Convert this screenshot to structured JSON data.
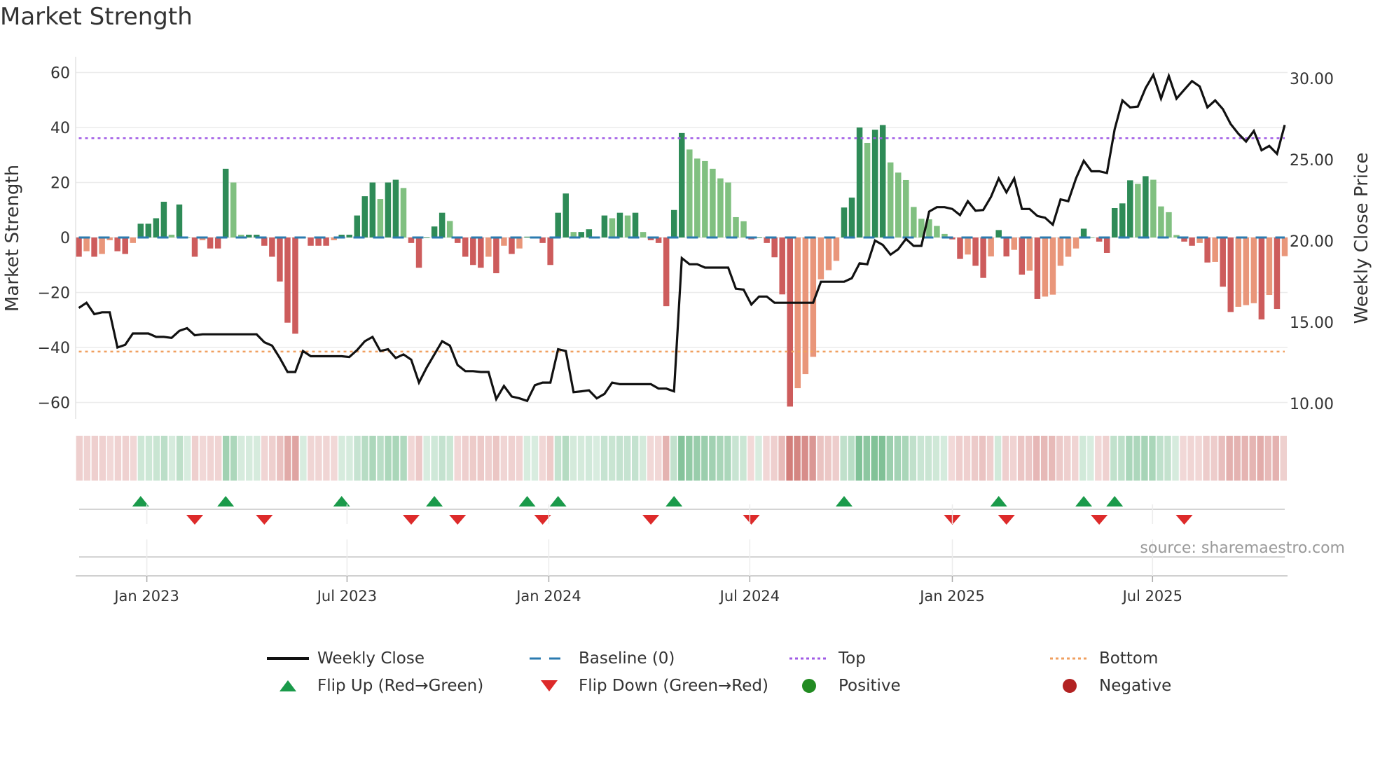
{
  "title": "Market Strength",
  "source": "source: sharemaestro.com",
  "colors": {
    "pos_strong": "#2e8b57",
    "pos_weak": "#80c080",
    "neg_strong": "#cd5c5c",
    "neg_weak": "#e9967a",
    "close": "#111111",
    "baseline": "#2b7bb0",
    "top": "#a05be6",
    "bottom": "#f0a060",
    "flip_up": "#1a9a4a",
    "flip_down": "#dd2a2a",
    "positive": "#228b22",
    "negative": "#b22222"
  },
  "legend": {
    "weekly_close": "Weekly Close",
    "baseline": "Baseline (0)",
    "top": "Top",
    "bottom": "Bottom",
    "flip_up": "Flip Up (Red→Green)",
    "flip_down": "Flip Down (Green→Red)",
    "positive": "Positive",
    "negative": "Negative"
  },
  "chart_data": {
    "type": "bar+line",
    "title": "Market Strength",
    "ylabel": "Market Strength",
    "y2label": "Weekly Close Price",
    "ylim": [
      -66,
      66
    ],
    "y2lim": [
      9.03,
      31.5
    ],
    "x_unit": "week index",
    "y_ticks": [
      {
        "value": 60,
        "label": "60"
      },
      {
        "value": 40,
        "label": "40"
      },
      {
        "value": 20,
        "label": "20"
      },
      {
        "value": 0,
        "label": "0"
      },
      {
        "value": -20,
        "label": "−20"
      },
      {
        "value": -40,
        "label": "−40"
      },
      {
        "value": -60,
        "label": "−60"
      }
    ],
    "y2_ticks": [
      {
        "value": 30,
        "label": "30.00"
      },
      {
        "value": 25,
        "label": "25.00"
      },
      {
        "value": 20,
        "label": "20.00"
      },
      {
        "value": 15,
        "label": "15.00"
      },
      {
        "value": 10,
        "label": "10.00"
      }
    ],
    "x_ticks": [
      {
        "week": 8.8,
        "label": "Jan 2023"
      },
      {
        "week": 34.7,
        "label": "Jul 2023"
      },
      {
        "week": 60.8,
        "label": "Jan 2024"
      },
      {
        "week": 86.8,
        "label": "Jul 2024"
      },
      {
        "week": 113.0,
        "label": "Jan 2025"
      },
      {
        "week": 138.9,
        "label": "Jul 2025"
      }
    ],
    "top_level": 36.1,
    "bottom_level": -41.5,
    "baseline": 0,
    "strength": [
      -7,
      -5,
      -7,
      -6,
      -1,
      -5,
      -6,
      -2,
      5,
      5,
      7,
      13,
      1,
      12,
      0,
      -7,
      -1,
      -4,
      -4,
      25,
      20,
      1,
      1,
      1,
      -3,
      -7,
      -16,
      -31,
      -35,
      0,
      -3,
      -3,
      -3,
      -1,
      1,
      1,
      8,
      15,
      20,
      14,
      20,
      21,
      18,
      -2,
      -11,
      0,
      4,
      9,
      6,
      -2,
      -7,
      -10,
      -11,
      -7,
      -13,
      -3,
      -6,
      -4,
      0.3,
      0,
      -2,
      -10,
      9,
      16,
      2,
      2,
      3,
      0,
      8,
      7,
      9,
      8,
      9,
      2,
      -1,
      -2,
      -25,
      10,
      38,
      32,
      28.7,
      27.8,
      25,
      21.5,
      20,
      7.4,
      5.9,
      -0.7,
      0,
      -2,
      -7.2,
      -20.7,
      -61.5,
      -54.8,
      -49.7,
      -43.4,
      -15.2,
      -11.9,
      -8.5,
      10.9,
      14.5,
      40,
      34.4,
      39.2,
      40.9,
      27.3,
      23.6,
      20.9,
      11.1,
      6.8,
      6.6,
      4.2,
      1.3,
      -0.7,
      -7.8,
      -6.2,
      -10.3,
      -14.7,
      -6.9,
      2.7,
      -6.9,
      -4.5,
      -13.5,
      -12.1,
      -22.4,
      -21.5,
      -20.8,
      -10.3,
      -7,
      -4,
      3.2,
      0,
      -1.5,
      -5.6,
      10.7,
      12.4,
      20.8,
      19.5,
      22.3,
      21,
      11.3,
      9.2,
      0.9,
      -1.5,
      -3,
      -2,
      -9.1,
      -8.9,
      -17.9,
      -27.1,
      -25.2,
      -24.6,
      -23.9,
      -29.8,
      -20.9,
      -26,
      -6.8
    ],
    "close": [
      15.88,
      16.2,
      15.5,
      15.61,
      15.61,
      13.45,
      13.61,
      14.31,
      14.31,
      14.31,
      14.1,
      14.1,
      14.04,
      14.47,
      14.64,
      14.2,
      14.26,
      14.26,
      14.26,
      14.26,
      14.26,
      14.26,
      14.26,
      14.26,
      13.77,
      13.56,
      12.8,
      11.94,
      11.94,
      13.23,
      12.91,
      12.91,
      12.91,
      12.91,
      12.91,
      12.86,
      13.29,
      13.83,
      14.1,
      13.23,
      13.34,
      12.8,
      13.02,
      12.7,
      11.29,
      12.21,
      13.02,
      13.83,
      13.56,
      12.37,
      11.99,
      11.99,
      11.94,
      11.94,
      10.27,
      11.08,
      10.43,
      10.32,
      10.16,
      11.13,
      11.29,
      11.29,
      13.34,
      13.23,
      10.7,
      10.75,
      10.81,
      10.32,
      10.59,
      11.29,
      11.19,
      11.19,
      11.19,
      11.19,
      11.19,
      10.92,
      10.92,
      10.75,
      18.95,
      18.57,
      18.57,
      18.36,
      18.36,
      18.36,
      18.36,
      17.06,
      17.01,
      16.09,
      16.58,
      16.58,
      16.2,
      16.2,
      16.2,
      16.2,
      16.2,
      16.2,
      17.49,
      17.49,
      17.49,
      17.49,
      17.71,
      18.63,
      18.57,
      20.03,
      19.76,
      19.16,
      19.49,
      20.13,
      19.7,
      19.7,
      21.81,
      22.08,
      22.08,
      21.97,
      21.59,
      22.45,
      21.86,
      21.91,
      22.72,
      23.85,
      22.99,
      23.85,
      21.97,
      21.97,
      21.54,
      21.43,
      21.0,
      22.56,
      22.45,
      23.85,
      24.93,
      24.29,
      24.29,
      24.18,
      26.87,
      28.65,
      28.22,
      28.27,
      29.41,
      30.22,
      28.76,
      30.16,
      28.76,
      29.3,
      29.84,
      29.51,
      28.22,
      28.65,
      28.11,
      27.2,
      26.6,
      26.12,
      26.77,
      25.58,
      25.85,
      25.36,
      27.14
    ],
    "flip_up_weeks": [
      8,
      19,
      34,
      46,
      58,
      62,
      77,
      99,
      119,
      130,
      134
    ],
    "flip_down_weeks": [
      15,
      24,
      43,
      49,
      60,
      74,
      87,
      113,
      120,
      132,
      143
    ],
    "grid": true,
    "legend_position": "bottom"
  }
}
